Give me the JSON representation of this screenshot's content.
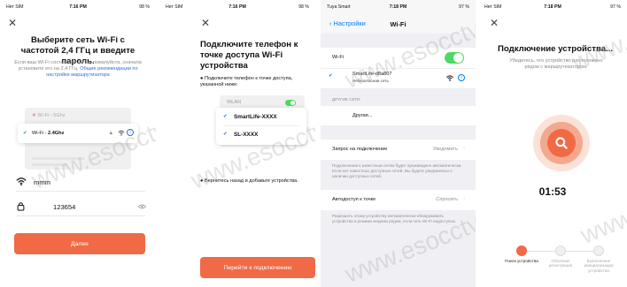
{
  "screen1": {
    "status": {
      "carrier": "Нет SIM",
      "time": "7:16 PM",
      "battery": "98 %"
    },
    "title": "Выберите сеть Wi-Fi с частотой 2,4 ГГц и введите пароль.",
    "subtitle": "Если ваш Wi-Fi составляет 5 ГГц, пожалуйста, сначала установите его на 2,4 ГГц.",
    "link": "Общие рекомендации по настройке маршрутизатора",
    "illus": {
      "bad": "Wi-Fi - 5Ghz",
      "good_prefix": "Wi-Fi - ",
      "good_band": "2.4Ghz"
    },
    "ssid": "mmm",
    "password": "123654",
    "next_button": "Далее"
  },
  "screen2": {
    "status": {
      "carrier": "Нет SIM",
      "time": "7:16 PM",
      "battery": "98 %"
    },
    "title": "Подключите телефон к точке доступа Wi-Fi устройства",
    "step1": "Подключите телефон к точке доступа, указанной ниже:",
    "wlan_label": "WLAN",
    "networks": [
      "SmartLife-XXXX",
      "SL-XXXX"
    ],
    "step2": "Вернитесь назад и добавьте устройства.",
    "connect_button": "Перейти к подключению"
  },
  "screen3": {
    "status": {
      "carrier": "Tuya Smart",
      "time": "7:18 PM",
      "battery": "97 %"
    },
    "back_label": "Настройки",
    "nav_title": "Wi-Fi",
    "wifi_label": "Wi-Fi",
    "current_network": "SmartLife-d8a807",
    "current_network_note": "Небезопасная сеть",
    "other_header": "ДРУГИЕ СЕТИ",
    "other_label": "Другая...",
    "ask_label": "Запрос на подключение",
    "ask_value": "Уведомить",
    "ask_note": "Подключение к известным сетям будет произведено автоматически. Если нет известных доступных сетей, Вы будете уведомлены о наличии доступных сетей.",
    "auto_label": "Автодоступ к точке",
    "auto_value": "Спросить",
    "auto_note": "Разрешить этому устройству автоматически обнаруживать устройства в режиме модема рядом, если сеть Wi-Fi недоступна."
  },
  "screen4": {
    "status": {
      "carrier": "Нет SIM",
      "time": "7:18 PM",
      "battery": "97 %"
    },
    "title": "Подключение устройства...",
    "subtitle": "Убедитесь, что устройство расположено рядом с маршрутизатором.",
    "timer": "01:53",
    "steps": [
      "Поиск устройства",
      "Облачная регистрация",
      "Выполнение инициализации устройства"
    ]
  },
  "watermark": "www.esocctv.ru",
  "colors": {
    "accent": "#f06a46",
    "link": "#2f6fd6",
    "ios_blue": "#007aff",
    "ios_green": "#4cd964"
  },
  "icons": [
    "wifi-icon",
    "lock-icon",
    "eye-icon",
    "check-icon",
    "close-icon",
    "search-icon",
    "info-icon",
    "chevron-left-icon",
    "chevron-right-icon"
  ]
}
